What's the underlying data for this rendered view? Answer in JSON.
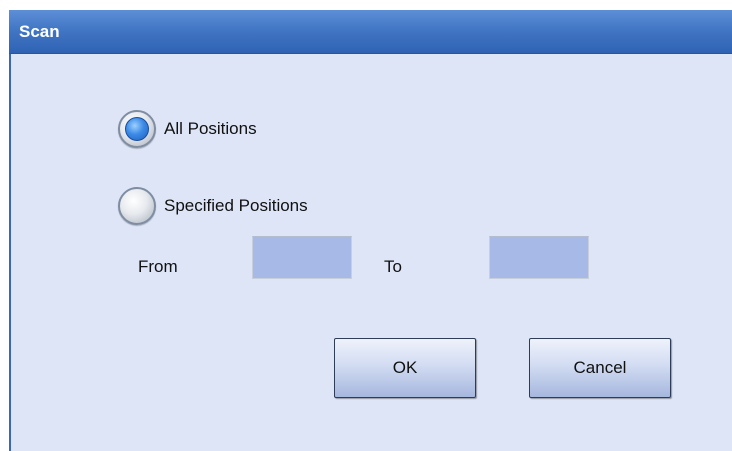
{
  "window": {
    "title": "Scan"
  },
  "scan_mode": {
    "selected": "all",
    "options": [
      {
        "id": "all",
        "label": "All Positions",
        "selected": true
      },
      {
        "id": "specified",
        "label": "Specified Positions",
        "selected": false
      }
    ]
  },
  "range": {
    "from_label": "From",
    "from_value": "",
    "to_label": "To",
    "to_value": ""
  },
  "buttons": {
    "ok_label": "OK",
    "cancel_label": "Cancel"
  },
  "colors": {
    "titlebar": "#4277c5",
    "client_background": "#dde5f7",
    "field_background": "#a7b9e6",
    "radio_selected": "#3c8be6"
  }
}
